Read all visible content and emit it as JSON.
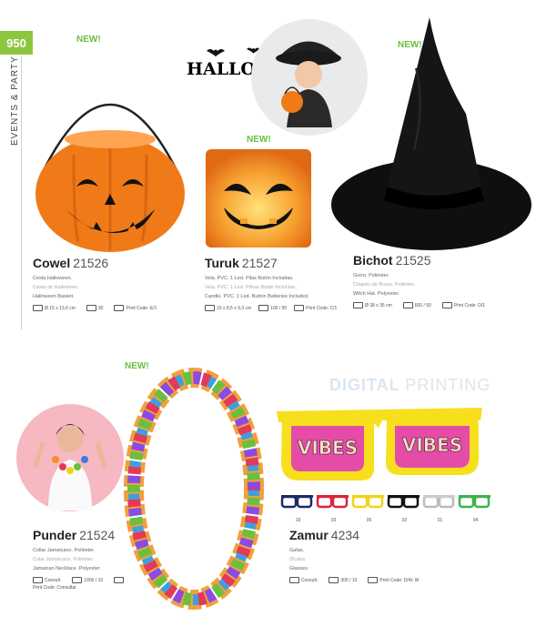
{
  "page": {
    "number": "950",
    "section": "EVENTS & PARTY"
  },
  "badges": {
    "new": "NEW!"
  },
  "banner": {
    "halloween": "HALLOWEEN",
    "digital_bold": "DIGITAL",
    "digital_light": "PRINTING"
  },
  "products": {
    "cowel": {
      "name": "Cowel",
      "code": "21526",
      "lines": [
        "Cesta Halloween.",
        "Cesta de Halloween.",
        "Halloween Basket."
      ],
      "size": "Ø 15 x 13,6 cm",
      "qty": "30",
      "print": "Print Code: E/1"
    },
    "turuk": {
      "name": "Turuk",
      "code": "21527",
      "lines": [
        "Vela. PVC. 1 Led. Pilas Botón Incluidas.",
        "Vela. PVC. 1 Led. Pilhas Botão Incluídas.",
        "Candle. PVC. 1 Led. Button Batteries Included."
      ],
      "size": "10 x 8,5 x 9,3 cm",
      "qty": "100 / 50",
      "print": "Print Code: C/1"
    },
    "bichot": {
      "name": "Bichot",
      "code": "21525",
      "lines": [
        "Gorro. Poliéster.",
        "Chapéu de Bruxa. Poliéster.",
        "Witch Hat. Polyester."
      ],
      "size": "Ø 38 x 35 cm",
      "qty": "600 / 50",
      "print": "Print Code: D/1"
    },
    "punder": {
      "name": "Punder",
      "code": "21524",
      "lines": [
        "Collar Jamaicano. Poliéster.",
        "Colar Jamaicano. Poliéster.",
        "Jamaican Necklace. Polyester."
      ],
      "size": "Consult.",
      "qty": "1000 / 10",
      "print": "Print Code: Consultar"
    },
    "zamur": {
      "name": "Zamur",
      "code": "4234",
      "lines": [
        "Gafas.",
        "Óculos.",
        "Glasses."
      ],
      "size": "Consult.",
      "qty": "300 / 10",
      "print": "Print Code: D/4L W"
    }
  },
  "glasses_variants": {
    "colors": [
      "#1a2a6b",
      "#d9243a",
      "#f2d21b",
      "#111111",
      "#f2f2f2",
      "#3bb34a"
    ],
    "numbers": [
      "19",
      "03",
      "05",
      "02",
      "01",
      "04"
    ]
  },
  "glasses_print": "VIBES",
  "colors": {
    "pumpkin": "#f07a17",
    "accent_green": "#6bbf3f",
    "lens_pink": "#e44ca8",
    "frame_yellow": "#f7df1e"
  }
}
